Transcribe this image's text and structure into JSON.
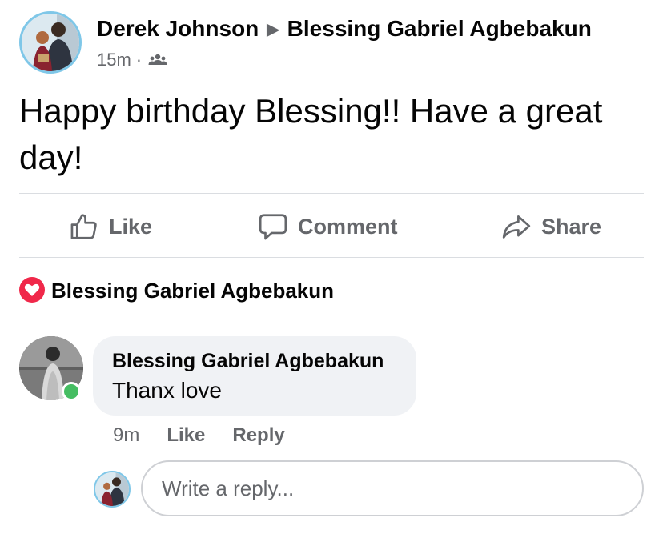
{
  "post": {
    "author": "Derek Johnson",
    "target": "Blessing Gabriel Agbebakun",
    "separator_glyph": "▶",
    "time": "15m",
    "meta_dot": "·",
    "audience_icon": "friends-icon",
    "text": "Happy birthday Blessing!! Have a great day!"
  },
  "actions": {
    "like": "Like",
    "comment": "Comment",
    "share": "Share"
  },
  "reactions": {
    "icon": "love-heart-icon",
    "name": "Blessing Gabriel Agbebakun"
  },
  "comment": {
    "author": "Blessing Gabriel Agbebakun",
    "text": "Thanx love",
    "time": "9m",
    "like_label": "Like",
    "reply_label": "Reply"
  },
  "reply": {
    "placeholder": "Write a reply..."
  },
  "colors": {
    "text": "#050505",
    "secondary": "#65676b",
    "bubble": "#f0f2f5",
    "divider": "#dadde1",
    "love": "#f0284a",
    "online": "#45bd62"
  }
}
